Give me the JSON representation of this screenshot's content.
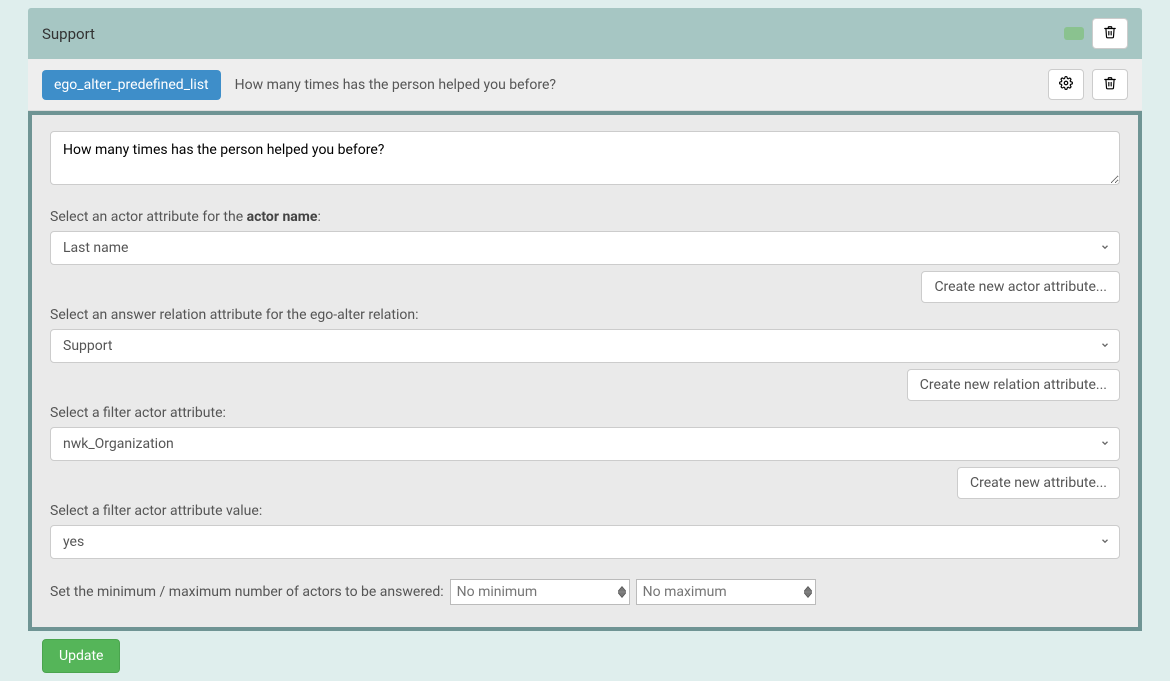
{
  "panel": {
    "title": "Support"
  },
  "question": {
    "type_badge": "ego_alter_predefined_list",
    "title": "How many times has the person helped you before?",
    "prompt_value": "How many times has the person helped you before?"
  },
  "fields": {
    "actor_name_label_prefix": "Select an actor attribute for the ",
    "actor_name_label_bold": "actor name",
    "actor_name_label_suffix": ":",
    "actor_name_value": "Last name",
    "create_actor_attr_btn": "Create new actor attribute...",
    "relation_label": "Select an answer relation attribute for the ego-alter relation:",
    "relation_value": "Support",
    "create_relation_attr_btn": "Create new relation attribute...",
    "filter_attr_label": "Select a filter actor attribute:",
    "filter_attr_value": "nwk_Organization",
    "create_attr_btn": "Create new attribute...",
    "filter_value_label": "Select a filter actor attribute value:",
    "filter_value_value": "yes",
    "minmax_label": "Set the minimum / maximum number of actors to be answered:",
    "min_placeholder": "No minimum",
    "max_placeholder": "No maximum"
  },
  "footer": {
    "update_btn": "Update"
  }
}
